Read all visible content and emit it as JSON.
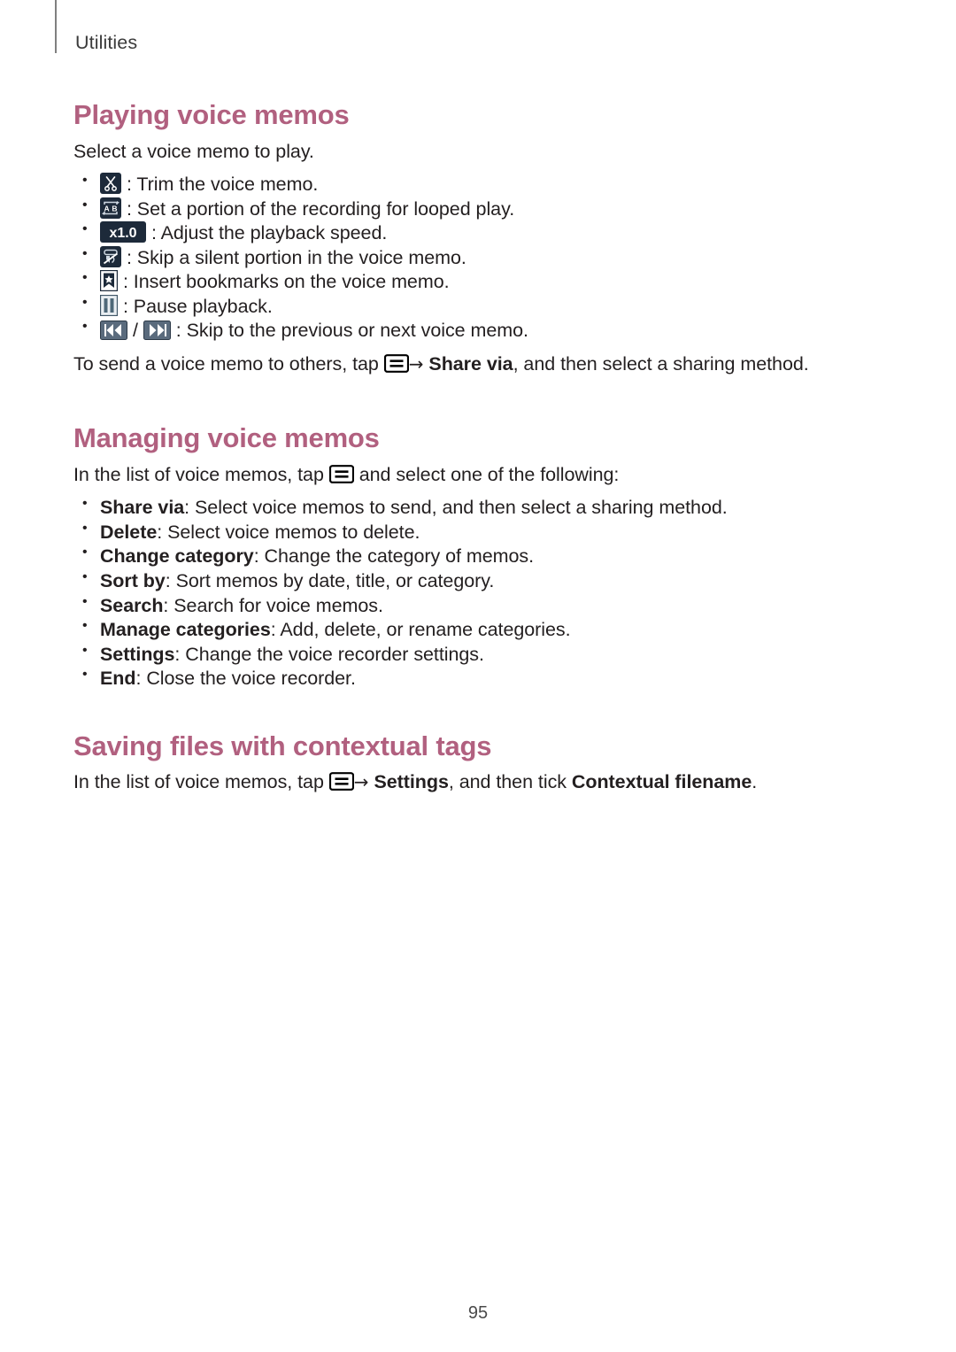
{
  "header": {
    "running_title": "Utilities"
  },
  "sections": [
    {
      "id": "playing-voice-memos",
      "heading": "Playing voice memos",
      "intro": "Select a voice memo to play.",
      "bullets": [
        {
          "icon": "scissors-icon",
          "text": ": Trim the voice memo."
        },
        {
          "icon": "ab-repeat-icon",
          "text": ": Set a portion of the recording for looped play."
        },
        {
          "icon": "playback-speed-icon",
          "icon_label": "x1.0",
          "text": ": Adjust the playback speed."
        },
        {
          "icon": "skip-silence-icon",
          "text": ": Skip a silent portion in the voice memo."
        },
        {
          "icon": "bookmark-icon",
          "text": ": Insert bookmarks on the voice memo."
        },
        {
          "icon": "pause-icon",
          "text": ": Pause playback."
        },
        {
          "icon": "skip-previous-next-icon",
          "text": ": Skip to the previous or next voice memo."
        }
      ],
      "outro": {
        "before_icon": "To send a voice memo to others, tap ",
        "arrow": "→",
        "bold_target": "Share via",
        "after": ", and then select a sharing method."
      }
    },
    {
      "id": "managing-voice-memos",
      "heading": "Managing voice memos",
      "intro": {
        "before_icon": "In the list of voice memos, tap ",
        "after_icon": " and select one of the following:"
      },
      "options": [
        {
          "term": "Share via",
          "description": ": Select voice memos to send, and then select a sharing method."
        },
        {
          "term": "Delete",
          "description": ": Select voice memos to delete."
        },
        {
          "term": "Change category",
          "description": ": Change the category of memos."
        },
        {
          "term": "Sort by",
          "description": ": Sort memos by date, title, or category."
        },
        {
          "term": "Search",
          "description": ": Search for voice memos."
        },
        {
          "term": "Manage categories",
          "description": ": Add, delete, or rename categories."
        },
        {
          "term": "Settings",
          "description": ": Change the voice recorder settings."
        },
        {
          "term": "End",
          "description": ": Close the voice recorder."
        }
      ]
    },
    {
      "id": "saving-files-with-contextual-tags",
      "heading": "Saving files with contextual tags",
      "intro": {
        "before_icon": "In the list of voice memos, tap ",
        "arrow": "→",
        "bold_target": "Settings",
        "middle": ", and then tick ",
        "bold_setting": "Contextual filename",
        "end": "."
      }
    }
  ],
  "footer": {
    "page_number": "95"
  },
  "colors": {
    "heading": "#b1607f",
    "body_text": "#231f20",
    "header_title": "#3b3b3b",
    "header_rule": "#808080",
    "icon_dark": "#1d2a3a",
    "icon_slate": "#5a6b7d",
    "page_number": "#4a4a4a"
  }
}
